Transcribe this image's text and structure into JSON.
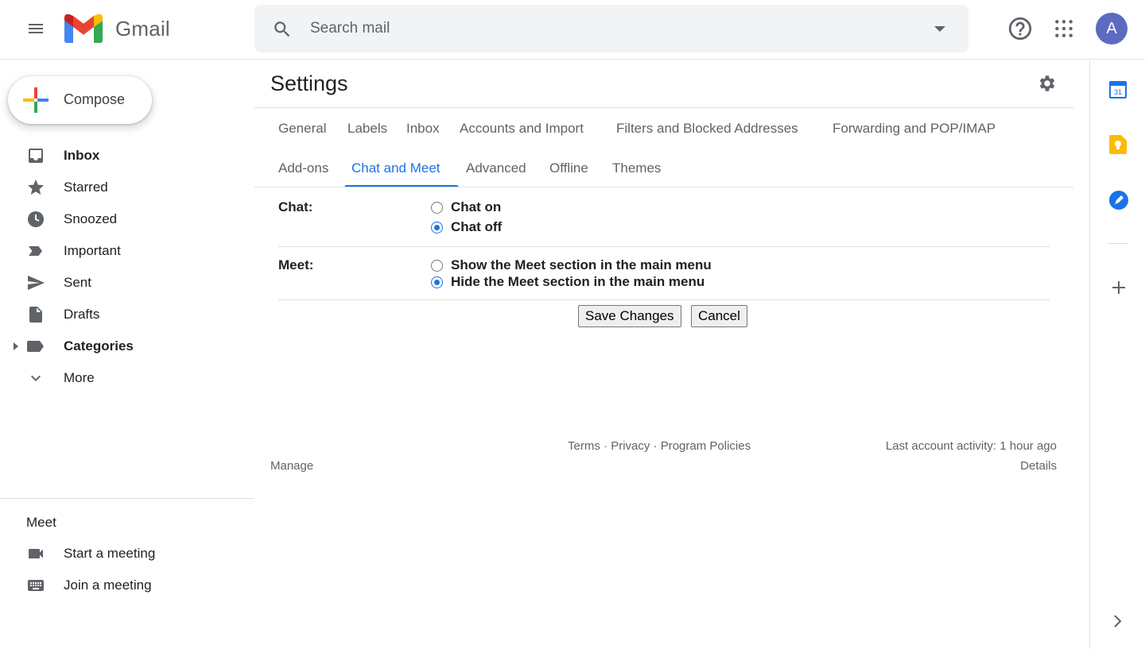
{
  "app": {
    "name": "Gmail"
  },
  "search": {
    "placeholder": "Search mail"
  },
  "user": {
    "avatar_letter": "A"
  },
  "sidebar": {
    "compose_label": "Compose",
    "items": [
      {
        "label": "Inbox",
        "icon": "inbox-icon",
        "bold": true
      },
      {
        "label": "Starred",
        "icon": "star-icon",
        "bold": false
      },
      {
        "label": "Snoozed",
        "icon": "clock-icon",
        "bold": false
      },
      {
        "label": "Important",
        "icon": "important-icon",
        "bold": false
      },
      {
        "label": "Sent",
        "icon": "send-icon",
        "bold": false
      },
      {
        "label": "Drafts",
        "icon": "draft-icon",
        "bold": false
      },
      {
        "label": "Categories",
        "icon": "label-icon",
        "bold": true
      },
      {
        "label": "More",
        "icon": "chevron-down-icon",
        "bold": false
      }
    ],
    "meet": {
      "title": "Meet",
      "items": [
        {
          "label": "Start a meeting",
          "icon": "videocam-icon"
        },
        {
          "label": "Join a meeting",
          "icon": "keyboard-icon"
        }
      ]
    }
  },
  "settings": {
    "title": "Settings",
    "tabs_row1": [
      "General",
      "Labels",
      "Inbox",
      "Accounts and Import",
      "Filters and Blocked Addresses",
      "Forwarding and POP/IMAP"
    ],
    "tabs_row2": [
      "Add-ons",
      "Chat and Meet",
      "Advanced",
      "Offline",
      "Themes"
    ],
    "active_tab": "Chat and Meet",
    "chat": {
      "label": "Chat:",
      "options": [
        {
          "label": "Chat on",
          "selected": false
        },
        {
          "label": "Chat off",
          "selected": true
        }
      ]
    },
    "meet": {
      "label": "Meet:",
      "options": [
        {
          "label": "Show the Meet section in the main menu",
          "selected": false
        },
        {
          "label": "Hide the Meet section in the main menu",
          "selected": true
        }
      ]
    },
    "save_label": "Save Changes",
    "cancel_label": "Cancel"
  },
  "footer": {
    "terms": "Terms",
    "sep": "·",
    "privacy": "Privacy",
    "policies": "Program Policies",
    "manage": "Manage",
    "activity": "Last account activity: 1 hour ago",
    "details": "Details"
  },
  "colors": {
    "accent": "#1a73e8",
    "avatar": "#5c6bc0"
  }
}
